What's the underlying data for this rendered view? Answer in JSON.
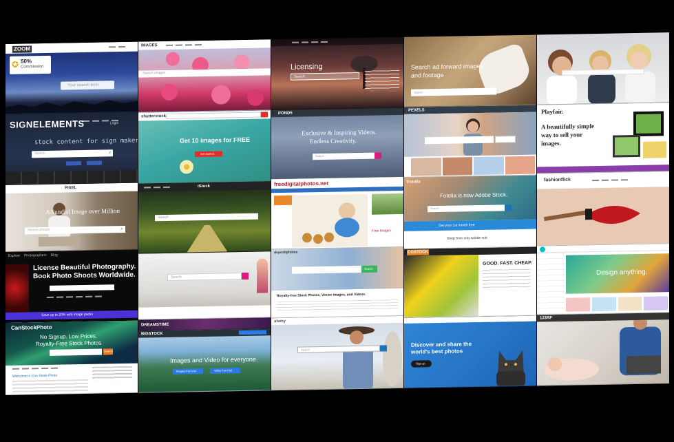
{
  "colors": {
    "background": "#000000",
    "accent_red": "#e52d27",
    "accent_magenta": "#e0197d",
    "accent_blue": "#1e73be"
  },
  "col1": {
    "zoom": {
      "logo": "ZOOM",
      "badge_line1": "50%",
      "badge_line2": "Commission",
      "search_placeholder": "Your search term"
    },
    "signelements": {
      "logo": "SIGNELEMENTS",
      "tagline": "stock content for sign makers",
      "search_placeholder": "Search",
      "login": "Login"
    },
    "pixel": {
      "logo": "PIXEL",
      "headline": "A Sundial Image over Million",
      "search_placeholder": "Search photos"
    },
    "shoots": {
      "nav": [
        "Explore",
        "Photographers",
        "Blog"
      ],
      "headline1": "License Beautiful Photography.",
      "headline2": "Book Photo Shoots Worldwide.",
      "promo": "Save up to 20% with image packs"
    },
    "canstock": {
      "logo": "CanStockPhoto",
      "headline1": "No Signup. Low Prices.",
      "headline2": "Royalty-Free Stock Photos",
      "search_button": "Search",
      "welcome": "Welcome to Can Stock Photo"
    }
  },
  "col2": {
    "blossom": {
      "logo": "IMAGES",
      "search_placeholder": "Search images"
    },
    "shutterstock": {
      "logo": "shutterstock",
      "headline": "Get 10 images for FREE",
      "cta": "Get started"
    },
    "istock": {
      "logo": "iStock",
      "search_placeholder": "Search"
    },
    "lake": {
      "search_placeholder": "Search"
    },
    "dreams": {
      "logo": "DREAMSTIME"
    },
    "bigstock": {
      "logo": "BIGSTOCK",
      "headline": "Images and Video for everyone.",
      "button1": "Images free trial",
      "button2": "Video free trial"
    }
  },
  "col3": {
    "licensing": {
      "title": "Licensing",
      "search_placeholder": "Search"
    },
    "pond5": {
      "logo": "POND5",
      "headline1": "Exclusive & Inspiring Videos.",
      "headline2": "Endless Creativity.",
      "search_placeholder": "Search"
    },
    "fdp": {
      "logo": "freedigitalphotos.net",
      "cta": "Free Images"
    },
    "deposit": {
      "logo": "depositphotos",
      "headline": "Royalty-free Stock Photos, Vector Images, and Videos.",
      "search_button": "Search"
    },
    "alamy": {
      "logo": "alamy",
      "search_placeholder": "Search"
    }
  },
  "col4": {
    "rug": {
      "headline1": "Search ad forward images",
      "headline2": "and footage",
      "search_placeholder": "Search"
    },
    "pexels": {
      "logo": "PEXELS"
    },
    "fotolia": {
      "logo": "Fotolia",
      "headline": "Fotolia is now Adobe Stock.",
      "search_placeholder": "Search",
      "promo": "Get your 1st month free",
      "footer": "Shop from only Adobe sub"
    },
    "cgstock": {
      "logo": "CGSTOCK",
      "headline": "GOOD. FAST. CHEAP."
    },
    "cat500": {
      "headline1": "Discover and share the",
      "headline2": "world's best photos",
      "cta": "Sign up"
    }
  },
  "col5": {
    "friends": {},
    "playfair": {
      "logo": "Playfair.",
      "headline1": "A beautifully simple",
      "headline2": "way to sell your",
      "headline3": "images."
    },
    "fashion": {
      "logo": "fashionflick"
    },
    "canva": {
      "headline": "Design anything."
    },
    "rf123": {
      "logo": "123RF"
    }
  }
}
